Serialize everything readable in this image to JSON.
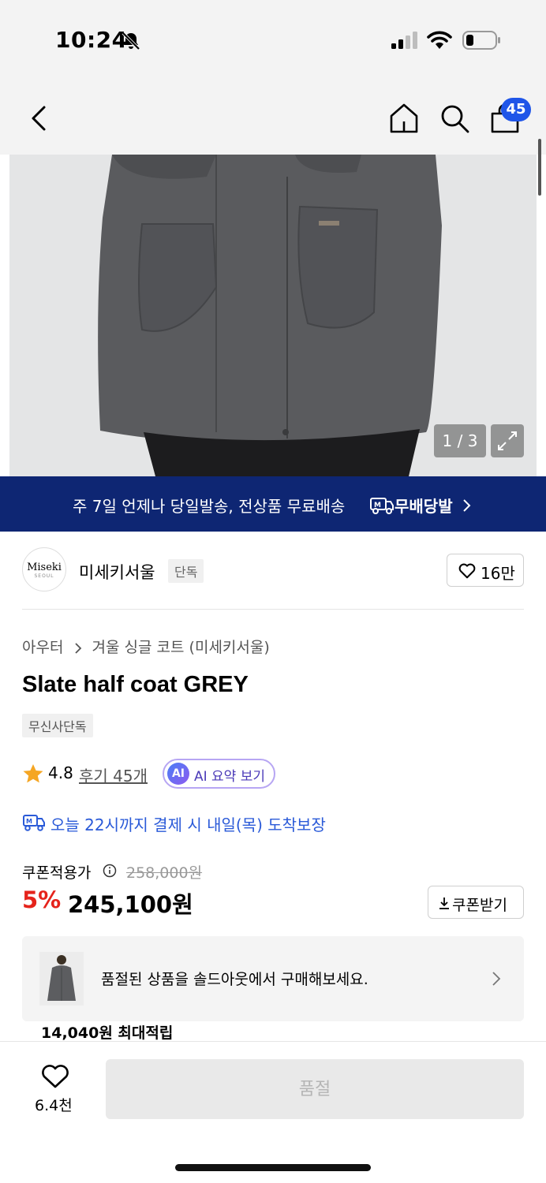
{
  "status_bar": {
    "time": "10:24",
    "icons": [
      "bell-slash-icon",
      "signal-icon",
      "wifi-icon",
      "battery-icon"
    ]
  },
  "nav": {
    "icons": [
      "back-icon",
      "home-icon",
      "search-icon",
      "cart-icon"
    ],
    "cart_count": "45"
  },
  "gallery": {
    "counter": "1 / 3",
    "expand_icon": "expand-icon"
  },
  "promo": {
    "text": "주 7일 언제나 당일발송, 전상품 무료배송",
    "brand": "무배당발",
    "icon": "delivery-truck-icon"
  },
  "brand": {
    "logo_text": "Miseki",
    "logo_sub": "SEOUL",
    "name": "미세키서울",
    "tag": "단독",
    "like_count": "16만"
  },
  "product": {
    "breadcrumb": [
      "아우터",
      "겨울 싱글 코트 (미세키서울)"
    ],
    "title": "Slate half coat GREY",
    "badge": "무신사단독",
    "rating": "4.8",
    "reviews": "후기 45개",
    "ai_chip": "AI",
    "ai_label": "AI 요약 보기",
    "delivery": "오늘 22시까지 결제 시 내일(목) 도착보장"
  },
  "price": {
    "label": "쿠폰적용가",
    "original": "258,000원",
    "discount": "5%",
    "sale": "245,100원",
    "coupon_button": "쿠폰받기"
  },
  "soldout_card": {
    "text": "품절된 상품을 솔드아웃에서 구매해보세요.",
    "points": "14,040원 최대적립"
  },
  "bottom": {
    "wish_count": "6.4천",
    "action": "품절"
  },
  "colors": {
    "accent_blue": "#1f55e8",
    "banner_navy": "#0e2673",
    "discount_red": "#e5231b",
    "ai_purple": "#4b3ab8"
  }
}
